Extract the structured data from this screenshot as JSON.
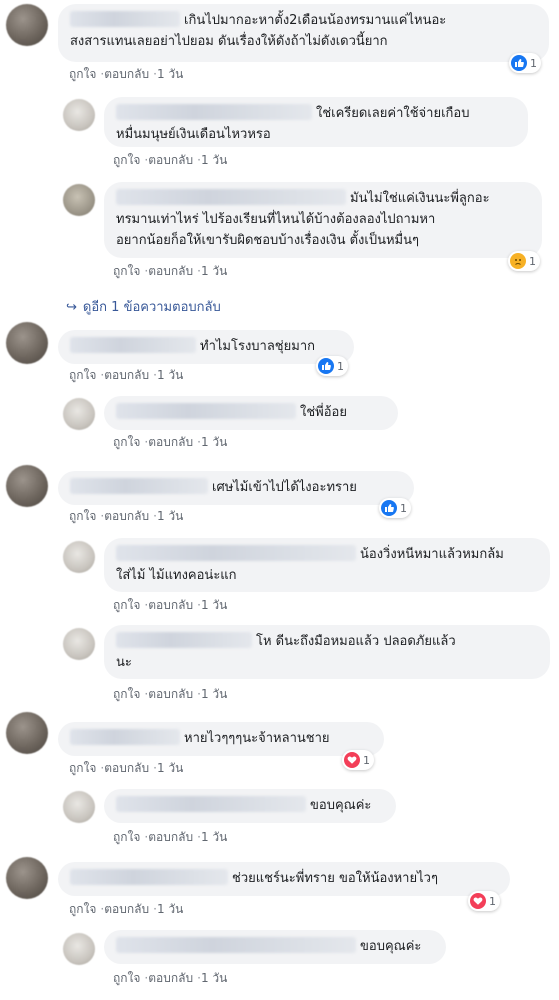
{
  "actions": {
    "like": "ถูกใจ",
    "reply": "ตอบกลับ",
    "time": "1 วัน"
  },
  "more_replies": "ดูอีก 1 ข้อความตอบกลับ",
  "reactions": {
    "count": "1"
  },
  "comments": [
    {
      "id": "c1",
      "text": "เกินไปมากอะหาตั้ง2เดือนน้องทรมานแค่ไหนอะ\nสงสารแทนเลยอย่าไปยอม ดันเรื่องให้ดังถ้าไม่ดังเดวนี้ยาก",
      "reaction": "like"
    },
    {
      "id": "r1",
      "text": "ใช่เครียดเลยค่าใช้จ่ายเกือบ\nหมื่นมนุษย์เงินเดือนไหวหรอ",
      "reaction": ""
    },
    {
      "id": "r2",
      "text": "มันไม่ใช่แค่เงินนะพี่ลูกอะ\nทรมานเท่าไหร่ ไปร้องเรียนที่ไหนได้บ้างต้องลองไปถามหา\nอยากน้อยก็อให้เขารับผิดชอบบ้างเรื่องเงิน ตั้งเป็นหมื่นๆ",
      "reaction": "sad"
    },
    {
      "id": "c2",
      "text": "ทำไมโรงบาลชุ่ยมาก",
      "reaction": "like"
    },
    {
      "id": "r3",
      "text": "ใช่พี่อ้อย",
      "reaction": ""
    },
    {
      "id": "c3",
      "text": "เศษไม้เข้าไปได้ไงอะทราย",
      "reaction": "like"
    },
    {
      "id": "r4",
      "text": "น้องวิ่งหนีหมาแล้วหมกล้ม\nใส่ไม้ ไม้แทงคอน่ะแก",
      "reaction": ""
    },
    {
      "id": "r5",
      "text": "โห ดีนะถึงมือหมอแล้ว ปลอดภัยแล้ว\nนะ",
      "reaction": ""
    },
    {
      "id": "c4",
      "text": "หายไวๆๆๆนะจ้าหลานชาย",
      "reaction": "love"
    },
    {
      "id": "r6",
      "text": "ขอบคุณค่ะ",
      "reaction": ""
    },
    {
      "id": "c5",
      "text": "ช่วยแชร์นะพี่ทราย ขอให้น้องหายไวๆ",
      "reaction": "love"
    },
    {
      "id": "r7",
      "text": "ขอบคุณค่ะ",
      "reaction": ""
    }
  ]
}
